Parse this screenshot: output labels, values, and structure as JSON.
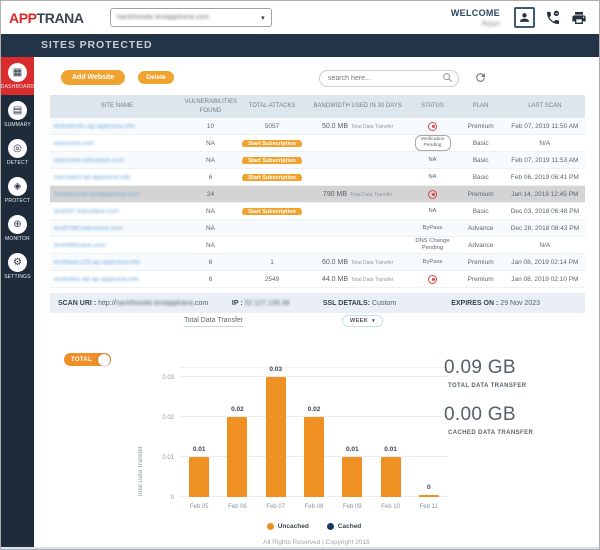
{
  "header": {
    "logo_part1": "APP",
    "logo_part2": "TRANA",
    "site_selector_value": "hackthissite.testapptrana.com",
    "welcome_label": "WELCOME",
    "user_name": "Arjun"
  },
  "title_bar": "SITES PROTECTED",
  "sidebar": {
    "items": [
      {
        "label": "DASHBOARD",
        "icon": "dashboard-grid",
        "glyph": "▦",
        "active": true
      },
      {
        "label": "SUMMARY",
        "icon": "summary-list",
        "glyph": "▤",
        "active": false
      },
      {
        "label": "DETECT",
        "icon": "detect-radar",
        "glyph": "◎",
        "active": false
      },
      {
        "label": "PROTECT",
        "icon": "protect-lock",
        "glyph": "◈",
        "active": false
      },
      {
        "label": "MONITOR",
        "icon": "monitor-scan",
        "glyph": "⊕",
        "active": false
      },
      {
        "label": "SETTINGS",
        "icon": "settings-gear",
        "glyph": "⚙",
        "active": false
      }
    ]
  },
  "toolbar": {
    "add_website_label": "Add Website",
    "delete_label": "Delete",
    "search_placeholder": "search here..."
  },
  "table": {
    "columns": [
      "SITE NAME",
      "VULNERABILITIES FOUND",
      "TOTAL ATTACKS",
      "BANDWIDTH USED IN 30 DAYS",
      "STATUS",
      "PLAN",
      "LAST SCAN"
    ],
    "bandwidth_suffix": "Total Data Transfer",
    "start_subscription_label": "Start Subscription",
    "rows": [
      {
        "site": "testsite24c-ap-apptrana.info",
        "site_blurred": true,
        "vulnerabilities": "10",
        "attacks": "5057",
        "attacks_button": false,
        "bandwidth": "50.0 MB",
        "status": {
          "type": "blocked-icon",
          "text": ""
        },
        "plan": "Premium",
        "last_scan": "Feb 07, 2019 11:50 AM",
        "selected": false
      },
      {
        "site": "airpocket.com",
        "site_blurred": true,
        "vulnerabilities": "NA",
        "attacks": "",
        "attacks_button": true,
        "bandwidth": "",
        "status": {
          "type": "bubble",
          "text": "Verification Pending"
        },
        "plan": "Basic",
        "last_scan": "N/A",
        "selected": false
      },
      {
        "site": "airpocket.indusface.com",
        "site_blurred": true,
        "vulnerabilities": "NA",
        "attacks": "",
        "attacks_button": true,
        "bandwidth": "",
        "status": {
          "type": "text",
          "text": "NA"
        },
        "plan": "Basic",
        "last_scan": "Feb 07, 2019 11:53 AM",
        "selected": false
      },
      {
        "site": "barcode3-ap-apptrana.info",
        "site_blurred": true,
        "vulnerabilities": "6",
        "attacks": "",
        "attacks_button": true,
        "bandwidth": "",
        "status": {
          "type": "text",
          "text": "NA"
        },
        "plan": "Basic",
        "last_scan": "Feb 06, 2019 06:41 PM",
        "selected": false
      },
      {
        "site": "hackthissite.testapptrana.com",
        "site_blurred": true,
        "vulnerabilities": "24",
        "attacks": "",
        "attacks_button": false,
        "bandwidth": "790 MB",
        "status": {
          "type": "blocked-icon",
          "text": ""
        },
        "plan": "Premium",
        "last_scan": "Jan 14, 2019 12:45 PM",
        "selected": true
      },
      {
        "site": "test037.indusface.com",
        "site_blurred": true,
        "vulnerabilities": "NA",
        "attacks": "",
        "attacks_button": true,
        "bandwidth": "",
        "status": {
          "type": "text",
          "text": "NA"
        },
        "plan": "Basic",
        "last_scan": "Dec 03, 2018 06:48 PM",
        "selected": false
      },
      {
        "site": "test0788.indusface.com",
        "site_blurred": true,
        "vulnerabilities": "NA",
        "attacks": "",
        "attacks_button": false,
        "bandwidth": "",
        "status": {
          "type": "text",
          "text": "ByPass"
        },
        "plan": "Advance",
        "last_scan": "Dec 28, 2018 08:43 PM",
        "selected": false
      },
      {
        "site": "test09thirane.com",
        "site_blurred": true,
        "vulnerabilities": "NA",
        "attacks": "",
        "attacks_button": false,
        "bandwidth": "",
        "status": {
          "type": "text",
          "text": "DNS Change Pending"
        },
        "plan": "Advance",
        "last_scan": "N/A",
        "selected": false
      },
      {
        "site": "testbasic125-ap-apptrana.info",
        "site_blurred": true,
        "vulnerabilities": "6",
        "attacks": "1",
        "attacks_button": false,
        "bandwidth": "60.0 MB",
        "status": {
          "type": "text",
          "text": "ByPass"
        },
        "plan": "Premium",
        "last_scan": "Jan 08, 2019 02:14 PM",
        "selected": false
      },
      {
        "site": "testholes-ab-ap-apptrana.info",
        "site_blurred": true,
        "vulnerabilities": "6",
        "attacks": "2549",
        "attacks_button": false,
        "bandwidth": "44.0 MB",
        "status": {
          "type": "blocked-icon",
          "text": ""
        },
        "plan": "Premium",
        "last_scan": "Jan 08, 2019 02:10 PM",
        "selected": false
      }
    ]
  },
  "scan_info": {
    "uri_label": "SCAN URI :",
    "uri_prefix": "http://",
    "uri_blurred": "hackthissite.testapptrana",
    "uri_suffix": ".com",
    "ip_label": "IP :",
    "ip_value": "52.127.139.38",
    "ip_blurred": true,
    "ssl_label": "SSL DETAILS:",
    "ssl_value": "Custom",
    "expires_label": "EXPIRES ON :",
    "expires_value": "29 Nov 2023"
  },
  "chart_data": {
    "type": "bar",
    "title": "Total Data Transfer",
    "period_selector": "WEEK",
    "toggle_label": "TOTAL",
    "ylabel": "Total Data Transfer",
    "yticks": [
      "0",
      "0.01",
      "0.02",
      "0.03"
    ],
    "ylim": [
      0,
      0.0325
    ],
    "grid": true,
    "legend_position": "bottom",
    "categories": [
      "Feb 05",
      "Feb 06",
      "Feb 07",
      "Feb 08",
      "Feb 09",
      "Feb 10",
      "Feb 11"
    ],
    "series": [
      {
        "name": "Uncached",
        "color": "#ee9122",
        "values": [
          0.01,
          0.02,
          0.03,
          0.02,
          0.01,
          0.01,
          0
        ]
      },
      {
        "name": "Cached",
        "color": "#173760",
        "values": [
          0,
          0,
          0,
          0,
          0,
          0,
          0
        ]
      }
    ],
    "bar_labels": [
      "0.01",
      "0.02",
      "0.03",
      "0.02",
      "0.01",
      "0.01",
      "0"
    ]
  },
  "stats": [
    {
      "value": "0.09 GB",
      "label": "TOTAL DATA TRANSFER"
    },
    {
      "value": "0.00 GB",
      "label": "CACHED DATA TRANSFER"
    }
  ],
  "footer": "All Rights Reserved | Copyright 2018",
  "colors": {
    "accent_orange": "#f1a32f",
    "brand_red": "#e02526",
    "navy": "#233447",
    "sidebar_navy": "#1d2b3b",
    "link_blue": "#70a8dc",
    "status_red": "#dc4343",
    "table_header_bg": "#dee6ed",
    "selected_row": "#d4d4d4"
  }
}
